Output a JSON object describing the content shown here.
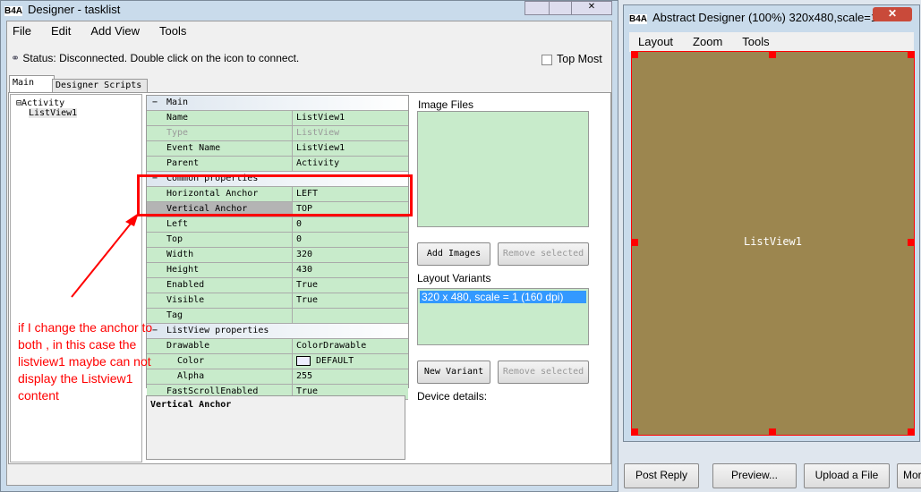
{
  "designer": {
    "title": "Designer - tasklist",
    "logo": "B4A",
    "menu": [
      "File",
      "Edit",
      "Add View",
      "Tools"
    ],
    "status": "Status: Disconnected. Double click on the icon to connect.",
    "top_most": "Top Most",
    "tabs": [
      "Main",
      "Designer Scripts"
    ],
    "tree": {
      "root": "Activity",
      "child": "ListView1"
    },
    "props": {
      "cat_main": "Main",
      "main": [
        [
          "Name",
          "ListView1"
        ],
        [
          "Type",
          "ListView"
        ],
        [
          "Event Name",
          "ListView1"
        ],
        [
          "Parent",
          "Activity"
        ]
      ],
      "cat_common": "Common properties",
      "common": [
        [
          "Horizontal Anchor",
          "LEFT"
        ],
        [
          "Vertical Anchor",
          "TOP"
        ],
        [
          "Left",
          "0"
        ],
        [
          "Top",
          "0"
        ],
        [
          "Width",
          "320"
        ],
        [
          "Height",
          "430"
        ],
        [
          "Enabled",
          "True"
        ],
        [
          "Visible",
          "True"
        ],
        [
          "Tag",
          ""
        ]
      ],
      "cat_lv": "ListView properties",
      "lv": [
        [
          "Drawable",
          "ColorDrawable"
        ],
        [
          "Color",
          "DEFAULT"
        ],
        [
          "Alpha",
          "255"
        ],
        [
          "FastScrollEnabled",
          "True"
        ]
      ]
    },
    "description": "Vertical Anchor",
    "image_files": "Image Files",
    "add_images": "Add Images",
    "remove_selected": "Remove selected",
    "layout_variants": "Layout Variants",
    "variant": "320 x 480, scale = 1 (160 dpi)",
    "new_variant": "New Variant",
    "device_details": "Device details:"
  },
  "annotation": "if I change the anchor to both , in this case the listview1 maybe can not display the Listview1 content",
  "abstract": {
    "title": "Abstract Designer (100%) 320x480,scale=1",
    "menu": [
      "Layout",
      "Zoom",
      "Tools"
    ],
    "view_label": "ListView1",
    "canvas_color": "#9c864f"
  },
  "bottom_buttons": [
    "Post Reply",
    "Preview...",
    "Upload a File",
    "Mor"
  ]
}
